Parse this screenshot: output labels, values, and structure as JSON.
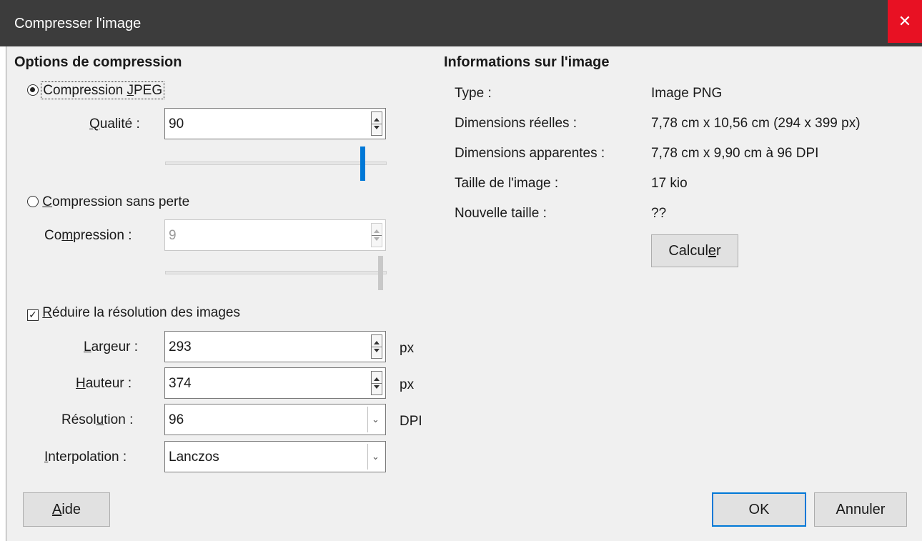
{
  "window": {
    "title": "Compresser l'image",
    "close_glyph": "✕"
  },
  "compression": {
    "heading": "Options de compression",
    "jpeg": {
      "pre": "Compression ",
      "key": "J",
      "post": "PEG",
      "selected": true
    },
    "quality": {
      "key": "Q",
      "post": "ualité :",
      "value": "90",
      "slider_level": 0.9
    },
    "lossless": {
      "key": "C",
      "post": "ompression sans perte",
      "selected": false
    },
    "lossless_level": {
      "pre": "Co",
      "key": "m",
      "post": "pression :",
      "value": "9",
      "slider_level": 1.0
    },
    "reduce": {
      "key": "R",
      "post": "éduire la résolution des images",
      "checked": true,
      "check_glyph": "✓"
    },
    "width": {
      "key": "L",
      "post": "argeur :",
      "value": "293",
      "unit": "px"
    },
    "height": {
      "key": "H",
      "post": "auteur :",
      "value": "374",
      "unit": "px"
    },
    "resolution": {
      "pre": "Résol",
      "key": "u",
      "post": "tion :",
      "value": "96",
      "unit": "DPI"
    },
    "interpolation": {
      "key": "I",
      "post": "nterpolation :",
      "value": "Lanczos"
    }
  },
  "info": {
    "heading": "Informations sur l'image",
    "type_label": "Type :",
    "type_value": "Image PNG",
    "real_label": "Dimensions réelles :",
    "real_value": "7,78 cm x 10,56 cm (294 x 399 px)",
    "apparent_label": "Dimensions apparentes :",
    "apparent_value": "7,78 cm x 9,90 cm à 96 DPI",
    "size_label": "Taille de l'image :",
    "size_value": "17 kio",
    "new_label": "Nouvelle taille :",
    "new_value": "??",
    "calc": {
      "pre": "Calcul",
      "key": "e",
      "post": "r"
    }
  },
  "buttons": {
    "help": {
      "key": "A",
      "post": "ide"
    },
    "ok": "OK",
    "cancel": "Annuler"
  },
  "colors": {
    "accent": "#0078d7",
    "close": "#e81123",
    "titlebar": "#3c3c3c",
    "disabled_thumb": "#c8c8c8"
  },
  "icons": {
    "spin": "spin-arrows-icon",
    "dropdown": "chevron-down-icon"
  }
}
